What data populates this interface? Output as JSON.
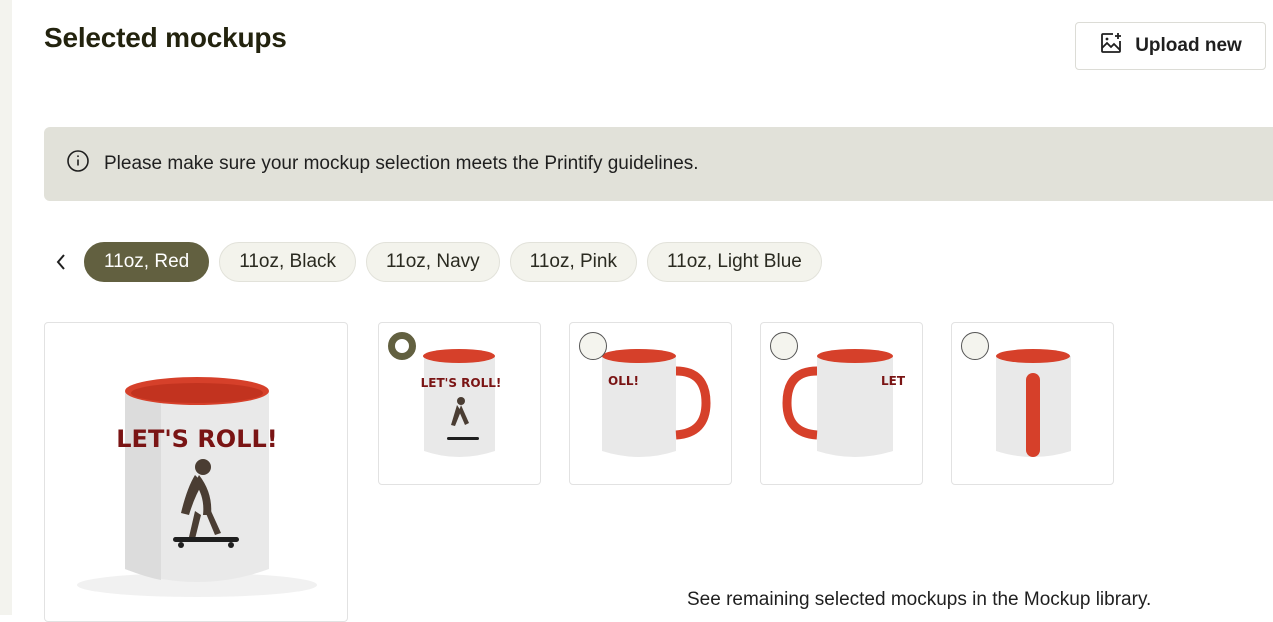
{
  "header": {
    "title": "Selected mockups",
    "upload_button_label": "Upload new",
    "upload_icon": "image-add-icon"
  },
  "banner": {
    "icon": "info-icon",
    "text": "Please make sure your mockup selection meets the Printify guidelines."
  },
  "variants": {
    "prev_icon": "chevron-left-icon",
    "items": [
      {
        "label": "11oz, Red",
        "selected": true
      },
      {
        "label": "11oz, Black",
        "selected": false
      },
      {
        "label": "11oz, Navy",
        "selected": false
      },
      {
        "label": "11oz, Pink",
        "selected": false
      },
      {
        "label": "11oz, Light Blue",
        "selected": false
      }
    ]
  },
  "mockups": {
    "preview_print_text": "LET'S ROLL!",
    "thumbnails": [
      {
        "view": "front",
        "selected": true
      },
      {
        "view": "right-handle",
        "selected": false
      },
      {
        "view": "left-handle",
        "selected": false
      },
      {
        "view": "back-handle",
        "selected": false
      }
    ]
  },
  "colors": {
    "accent": "#626040",
    "mug_red": "#d6402a",
    "banner_bg": "#e1e1d9"
  },
  "footer": {
    "note": "See remaining selected mockups in the Mockup library."
  }
}
